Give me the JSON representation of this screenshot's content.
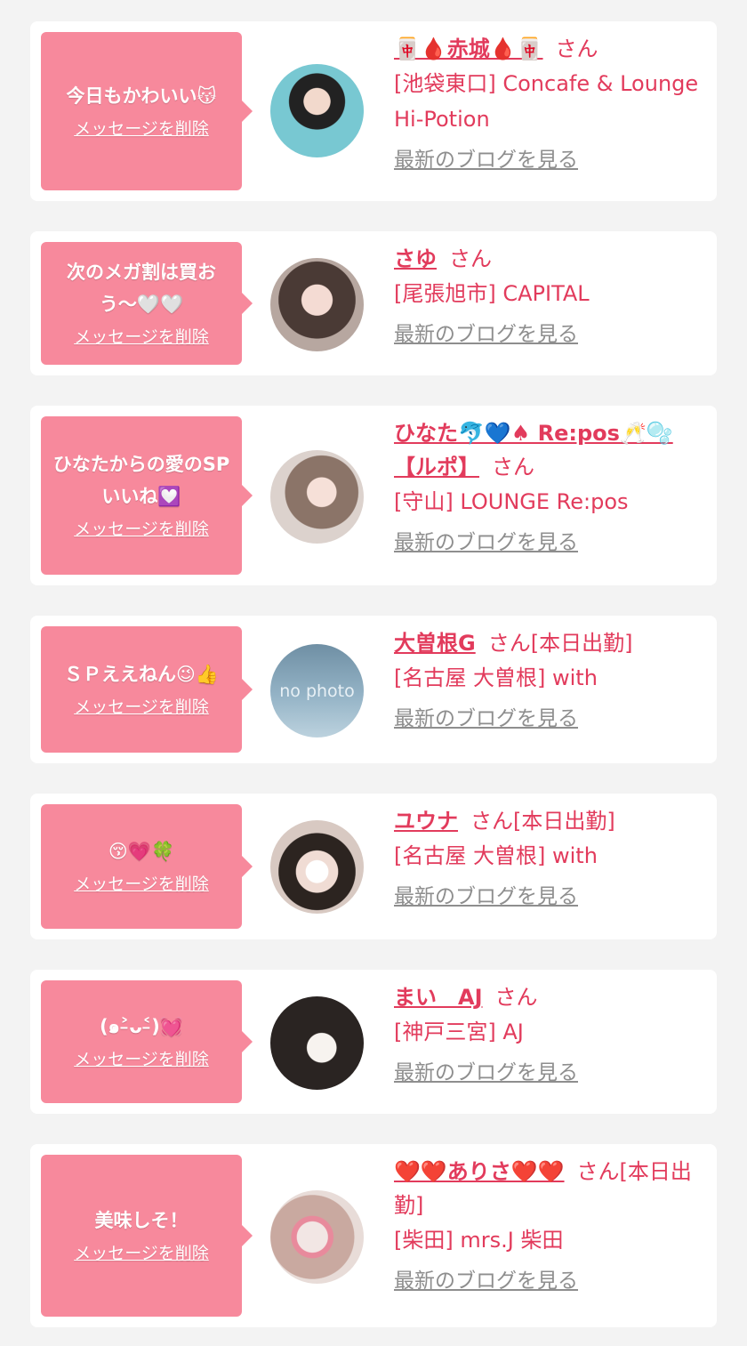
{
  "items": [
    {
      "message": "今日もかわいい😽",
      "delete_label": "メッセージを削除",
      "name": "🀄🩸赤城🩸🀄",
      "san": "さん",
      "shop": "[池袋東口] Concafe & Lounge Hi-Potion",
      "blog_label": "最新のブログを見る"
    },
    {
      "message": "次のメガ割は買おう〜🤍🤍",
      "delete_label": "メッセージを削除",
      "name": "さゆ",
      "san": "さん",
      "shop": "[尾張旭市] CAPITAL",
      "blog_label": "最新のブログを見る"
    },
    {
      "message": "ひなたからの愛のSPいいね💟",
      "delete_label": "メッセージを削除",
      "name": "ひなた🐬💙♠ Re:pos🥂🫧【ルポ】",
      "san": "さん",
      "shop": "[守山] LOUNGE Re:pos",
      "blog_label": "最新のブログを見る"
    },
    {
      "message": "ＳＰええねん😉👍",
      "delete_label": "メッセージを削除",
      "name": "大曽根G",
      "san": "さん[本日出勤]",
      "shop": "[名古屋 大曽根] with",
      "blog_label": "最新のブログを見る",
      "avatar_text": "no photo"
    },
    {
      "message": "😚💗🍀",
      "delete_label": "メッセージを削除",
      "name": "ユウナ",
      "san": "さん[本日出勤]",
      "shop": "[名古屋 大曽根] with",
      "blog_label": "最新のブログを見る"
    },
    {
      "message": "(๑˃̵ᴗ˂̵)💓",
      "delete_label": "メッセージを削除",
      "name": "まい　AJ",
      "san": "さん",
      "shop": "[神戸三宮] AJ",
      "blog_label": "最新のブログを見る"
    },
    {
      "message": "美味しそ！",
      "delete_label": "メッセージを削除",
      "name": "❤️❤️ありさ❤️❤️",
      "san": "さん[本日出勤]",
      "shop": "[柴田] mrs.J 柴田",
      "blog_label": "最新のブログを見る"
    }
  ],
  "colors": {
    "bubble": "#f7899c",
    "accent": "#e23b5c",
    "link_gray": "#8e8e8e",
    "background": "#f3f3f3"
  }
}
